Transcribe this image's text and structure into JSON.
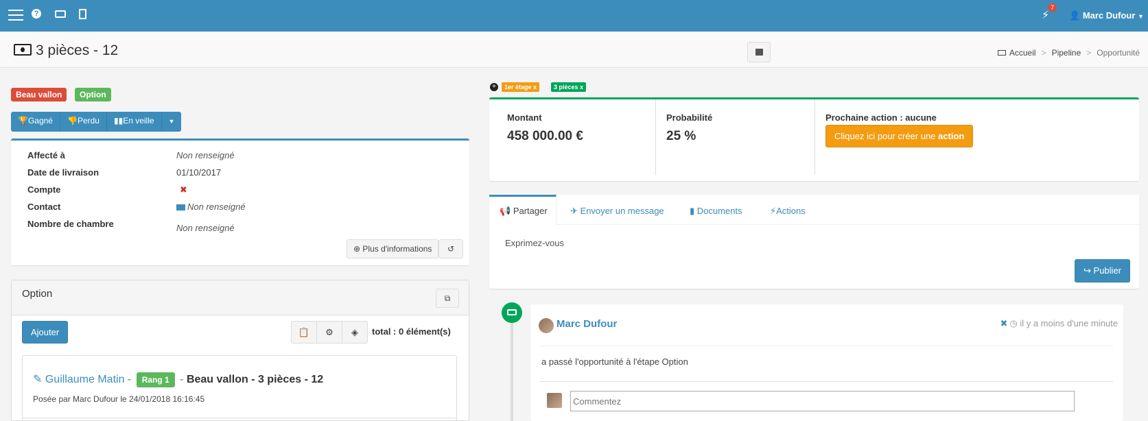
{
  "navbar": {
    "notification_count": "7",
    "user_name": "Marc Dufour"
  },
  "header": {
    "title": "3 pièces - 12",
    "breadcrumb": [
      "Accueil",
      "Pipeline",
      "Opportunité"
    ]
  },
  "labels": {
    "location": "Beau vallon",
    "stage": "Option"
  },
  "status_buttons": {
    "won": "Gagné",
    "lost": "Perdu",
    "standby": "En veille"
  },
  "details": {
    "assigned_label": "Affecté à",
    "assigned_value": "Non renseigné",
    "delivery_label": "Date de livraison",
    "delivery_value": "01/10/2017",
    "account_label": "Compte",
    "account_value": "✖",
    "contact_label": "Contact",
    "contact_value": "Non renseigné",
    "rooms_label": "Nombre de chambre",
    "rooms_value": "Non renseigné",
    "more_info_button": "Plus d'informations"
  },
  "option_panel": {
    "title": "Option",
    "add_button": "Ajouter",
    "total": "total : 0 élément(s)",
    "card": {
      "author": "Guillaume Matin",
      "rank": "Rang 1",
      "subject": "Beau vallon - 3 pièces - 12",
      "posted": "Posée par Marc Dufour le 24/01/2018 16:16:45"
    }
  },
  "stage_tags": {
    "tag1": "1er étage x",
    "tag2": "3 pièces x"
  },
  "metrics": {
    "amount_label": "Montant",
    "amount_value": "458 000.00 €",
    "probability_label": "Probabilité",
    "probability_value": "25 %",
    "next_action_label": "Prochaine action : aucune",
    "create_action_prefix": "Cliquez ici pour créer une",
    "create_action_bold": "action"
  },
  "tabs": {
    "share": "Partager",
    "message": "Envoyer un message",
    "documents": "Documents",
    "actions": "Actions",
    "placeholder": "Exprimez-vous",
    "publish_button": "Publier"
  },
  "timeline": {
    "user": "Marc Dufour",
    "time": "il y a moins d'une minute",
    "body": "a passé l'opportunité à l'étape Option",
    "comment_placeholder": "Commentez"
  },
  "colors": {
    "primary": "#3c8dbc",
    "danger": "#dd4b39",
    "success": "#5cb85c",
    "green": "#00a65a",
    "warning": "#f39c12"
  }
}
